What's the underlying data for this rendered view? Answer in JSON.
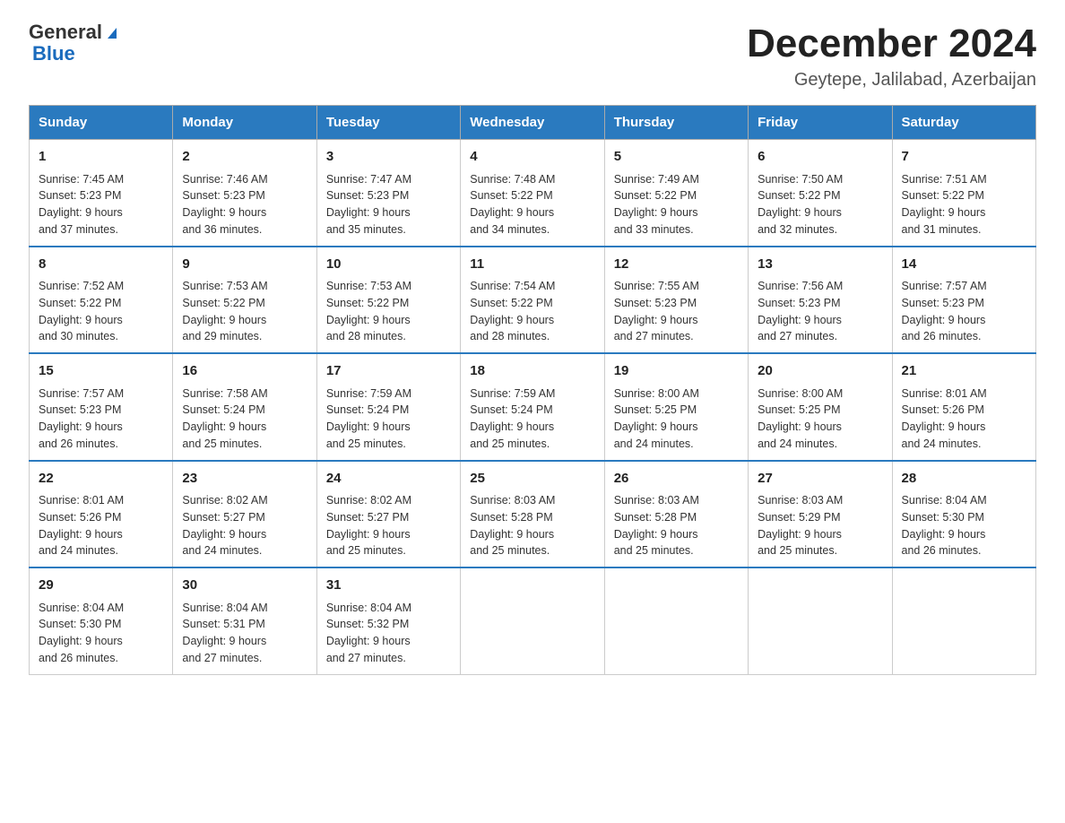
{
  "header": {
    "logo_general": "General",
    "logo_blue": "Blue",
    "month_title": "December 2024",
    "location": "Geytepe, Jalilabad, Azerbaijan"
  },
  "days_of_week": [
    "Sunday",
    "Monday",
    "Tuesday",
    "Wednesday",
    "Thursday",
    "Friday",
    "Saturday"
  ],
  "weeks": [
    [
      {
        "day": "1",
        "sunrise": "7:45 AM",
        "sunset": "5:23 PM",
        "daylight": "9 hours and 37 minutes."
      },
      {
        "day": "2",
        "sunrise": "7:46 AM",
        "sunset": "5:23 PM",
        "daylight": "9 hours and 36 minutes."
      },
      {
        "day": "3",
        "sunrise": "7:47 AM",
        "sunset": "5:23 PM",
        "daylight": "9 hours and 35 minutes."
      },
      {
        "day": "4",
        "sunrise": "7:48 AM",
        "sunset": "5:22 PM",
        "daylight": "9 hours and 34 minutes."
      },
      {
        "day": "5",
        "sunrise": "7:49 AM",
        "sunset": "5:22 PM",
        "daylight": "9 hours and 33 minutes."
      },
      {
        "day": "6",
        "sunrise": "7:50 AM",
        "sunset": "5:22 PM",
        "daylight": "9 hours and 32 minutes."
      },
      {
        "day": "7",
        "sunrise": "7:51 AM",
        "sunset": "5:22 PM",
        "daylight": "9 hours and 31 minutes."
      }
    ],
    [
      {
        "day": "8",
        "sunrise": "7:52 AM",
        "sunset": "5:22 PM",
        "daylight": "9 hours and 30 minutes."
      },
      {
        "day": "9",
        "sunrise": "7:53 AM",
        "sunset": "5:22 PM",
        "daylight": "9 hours and 29 minutes."
      },
      {
        "day": "10",
        "sunrise": "7:53 AM",
        "sunset": "5:22 PM",
        "daylight": "9 hours and 28 minutes."
      },
      {
        "day": "11",
        "sunrise": "7:54 AM",
        "sunset": "5:22 PM",
        "daylight": "9 hours and 28 minutes."
      },
      {
        "day": "12",
        "sunrise": "7:55 AM",
        "sunset": "5:23 PM",
        "daylight": "9 hours and 27 minutes."
      },
      {
        "day": "13",
        "sunrise": "7:56 AM",
        "sunset": "5:23 PM",
        "daylight": "9 hours and 27 minutes."
      },
      {
        "day": "14",
        "sunrise": "7:57 AM",
        "sunset": "5:23 PM",
        "daylight": "9 hours and 26 minutes."
      }
    ],
    [
      {
        "day": "15",
        "sunrise": "7:57 AM",
        "sunset": "5:23 PM",
        "daylight": "9 hours and 26 minutes."
      },
      {
        "day": "16",
        "sunrise": "7:58 AM",
        "sunset": "5:24 PM",
        "daylight": "9 hours and 25 minutes."
      },
      {
        "day": "17",
        "sunrise": "7:59 AM",
        "sunset": "5:24 PM",
        "daylight": "9 hours and 25 minutes."
      },
      {
        "day": "18",
        "sunrise": "7:59 AM",
        "sunset": "5:24 PM",
        "daylight": "9 hours and 25 minutes."
      },
      {
        "day": "19",
        "sunrise": "8:00 AM",
        "sunset": "5:25 PM",
        "daylight": "9 hours and 24 minutes."
      },
      {
        "day": "20",
        "sunrise": "8:00 AM",
        "sunset": "5:25 PM",
        "daylight": "9 hours and 24 minutes."
      },
      {
        "day": "21",
        "sunrise": "8:01 AM",
        "sunset": "5:26 PM",
        "daylight": "9 hours and 24 minutes."
      }
    ],
    [
      {
        "day": "22",
        "sunrise": "8:01 AM",
        "sunset": "5:26 PM",
        "daylight": "9 hours and 24 minutes."
      },
      {
        "day": "23",
        "sunrise": "8:02 AM",
        "sunset": "5:27 PM",
        "daylight": "9 hours and 24 minutes."
      },
      {
        "day": "24",
        "sunrise": "8:02 AM",
        "sunset": "5:27 PM",
        "daylight": "9 hours and 25 minutes."
      },
      {
        "day": "25",
        "sunrise": "8:03 AM",
        "sunset": "5:28 PM",
        "daylight": "9 hours and 25 minutes."
      },
      {
        "day": "26",
        "sunrise": "8:03 AM",
        "sunset": "5:28 PM",
        "daylight": "9 hours and 25 minutes."
      },
      {
        "day": "27",
        "sunrise": "8:03 AM",
        "sunset": "5:29 PM",
        "daylight": "9 hours and 25 minutes."
      },
      {
        "day": "28",
        "sunrise": "8:04 AM",
        "sunset": "5:30 PM",
        "daylight": "9 hours and 26 minutes."
      }
    ],
    [
      {
        "day": "29",
        "sunrise": "8:04 AM",
        "sunset": "5:30 PM",
        "daylight": "9 hours and 26 minutes."
      },
      {
        "day": "30",
        "sunrise": "8:04 AM",
        "sunset": "5:31 PM",
        "daylight": "9 hours and 27 minutes."
      },
      {
        "day": "31",
        "sunrise": "8:04 AM",
        "sunset": "5:32 PM",
        "daylight": "9 hours and 27 minutes."
      },
      null,
      null,
      null,
      null
    ]
  ],
  "labels": {
    "sunrise": "Sunrise:",
    "sunset": "Sunset:",
    "daylight": "Daylight:"
  }
}
